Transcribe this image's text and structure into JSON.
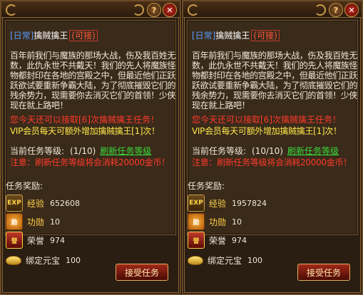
{
  "panels": [
    {
      "tag": "[日常]",
      "task_name": "擒贼擒王",
      "repeat": "(可接)",
      "story": "百年前我们与魔族的那场大战，伤及我百姓无数，此仇永世不共戴天！我们的先人将魔族怪物都封印在各地的宫殿之中，但最近他们正跃跃欲试要重新争霸大陆，为了彻底摧毁它们的残余势力，现需要你去消灭它们的首领！少侠现在就上路吧！",
      "notice": "您今天还可以接取[6]次擒贼擒王任务！",
      "vip": "VIP会员每天可额外增加擒贼擒王[1]次！",
      "level_label": "当前任务等级:",
      "level_value": "(1/10)",
      "refresh": "刷新任务等级",
      "warn": "注意：刷新任务等级将会消耗20000金币！",
      "rewards_label": "任务奖励:",
      "rewards": [
        {
          "icon": "exp-icon",
          "name": "经验",
          "value": "652608"
        },
        {
          "icon": "merit-medal-icon",
          "name": "功勋",
          "value": "10"
        },
        {
          "icon": "honor-badge-icon",
          "name": "荣誉",
          "value": "974"
        },
        {
          "icon": "gold-ingot-icon",
          "name": "绑定元宝",
          "value": "100"
        }
      ],
      "accept": "接受任务"
    },
    {
      "tag": "[日常]",
      "task_name": "擒贼擒王",
      "repeat": "(可接)",
      "story": "百年前我们与魔族的那场大战，伤及我百姓无数，此仇永世不共戴天！我们的先人将魔族怪物都封印在各地的宫殿之中，但最近他们正跃跃欲试要重新争霸大陆，为了彻底摧毁它们的残余势力，现需要你去消灭它们的首领！少侠现在就上路吧！",
      "notice": "您今天还可以接取[6]次擒贼擒王任务！",
      "vip": "VIP会员每天可额外增加擒贼擒王[1]次！",
      "level_label": "当前任务等级:",
      "level_value": "(10/10)",
      "refresh": "刷新任务等级",
      "warn": "注意：刷新任务等级将会消耗20000金币！",
      "rewards_label": "任务奖励:",
      "rewards": [
        {
          "icon": "exp-icon",
          "name": "经验",
          "value": "1957824"
        },
        {
          "icon": "merit-medal-icon",
          "name": "功勋",
          "value": "10"
        },
        {
          "icon": "honor-badge-icon",
          "name": "荣誉",
          "value": "974"
        },
        {
          "icon": "gold-ingot-icon",
          "name": "绑定元宝",
          "value": "100"
        }
      ],
      "accept": "接受任务"
    }
  ],
  "icons": {
    "help": "?",
    "close": "✕",
    "exp": "EXP",
    "merit": "勋",
    "honor": "誉"
  }
}
